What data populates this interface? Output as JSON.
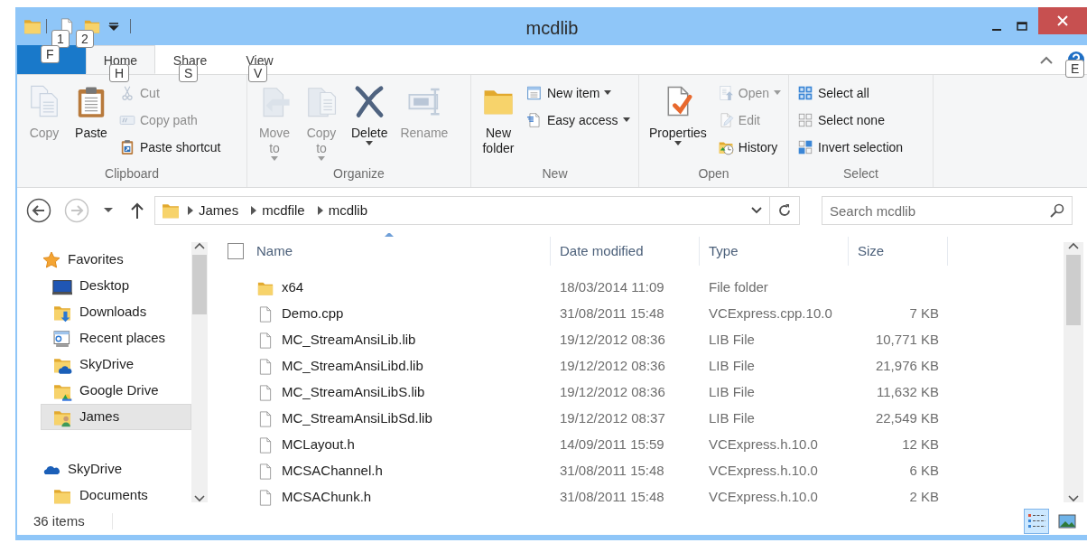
{
  "title_bar": {
    "title": "mcdlib",
    "keytips": [
      "1",
      "2"
    ]
  },
  "ribbon": {
    "file_tab": {
      "keytip": "F"
    },
    "tabs": [
      {
        "label": "Home",
        "keytip": "H",
        "selected": true
      },
      {
        "label": "Share",
        "keytip": "S",
        "selected": false
      },
      {
        "label": "View",
        "keytip": "V",
        "selected": false
      }
    ],
    "help_keytip": "E",
    "groups": [
      {
        "label": "Clipboard",
        "items": [
          {
            "kind": "large",
            "label": "Copy",
            "disabled": true,
            "dropdown": false
          },
          {
            "kind": "large",
            "label": "Paste",
            "disabled": false,
            "dropdown": false
          },
          {
            "kind": "small",
            "label": "Cut",
            "disabled": true,
            "dropdown": false
          },
          {
            "kind": "small",
            "label": "Copy path",
            "disabled": true,
            "dropdown": false
          },
          {
            "kind": "small",
            "label": "Paste shortcut",
            "disabled": false,
            "dropdown": false
          }
        ]
      },
      {
        "label": "Organize",
        "items": [
          {
            "kind": "large",
            "label": "Move to",
            "disabled": true,
            "dropdown": true
          },
          {
            "kind": "large",
            "label": "Copy to",
            "disabled": true,
            "dropdown": true
          },
          {
            "kind": "large",
            "label": "Delete",
            "disabled": false,
            "dropdown": true
          },
          {
            "kind": "large",
            "label": "Rename",
            "disabled": true,
            "dropdown": false
          }
        ]
      },
      {
        "label": "New",
        "items": [
          {
            "kind": "large",
            "label": "New folder",
            "disabled": false,
            "dropdown": false
          },
          {
            "kind": "small",
            "label": "New item",
            "disabled": false,
            "dropdown": true
          },
          {
            "kind": "small",
            "label": "Easy access",
            "disabled": false,
            "dropdown": true
          }
        ]
      },
      {
        "label": "Open",
        "items": [
          {
            "kind": "large",
            "label": "Properties",
            "disabled": false,
            "dropdown": true
          },
          {
            "kind": "small",
            "label": "Open",
            "disabled": true,
            "dropdown": true
          },
          {
            "kind": "small",
            "label": "Edit",
            "disabled": true,
            "dropdown": false
          },
          {
            "kind": "small",
            "label": "History",
            "disabled": false,
            "dropdown": false
          }
        ]
      },
      {
        "label": "Select",
        "items": [
          {
            "kind": "small",
            "label": "Select all",
            "disabled": false,
            "dropdown": false
          },
          {
            "kind": "small",
            "label": "Select none",
            "disabled": false,
            "dropdown": false
          },
          {
            "kind": "small",
            "label": "Invert selection",
            "disabled": false,
            "dropdown": false
          }
        ]
      }
    ]
  },
  "navigation": {
    "forward_disabled": true,
    "breadcrumbs": [
      "James",
      "mcdfile",
      "mcdlib"
    ],
    "search": {
      "placeholder": "Search mcdlib"
    }
  },
  "sidebar": {
    "items": [
      {
        "label": "Favorites",
        "selected": false,
        "children": [
          {
            "label": "Desktop",
            "selected": false
          },
          {
            "label": "Downloads",
            "selected": false
          },
          {
            "label": "Recent places",
            "selected": false
          },
          {
            "label": "SkyDrive",
            "selected": false
          },
          {
            "label": "Google Drive",
            "selected": false
          },
          {
            "label": "James",
            "selected": true
          }
        ]
      },
      {
        "label": "SkyDrive",
        "selected": false,
        "children": [
          {
            "label": "Documents",
            "selected": false
          }
        ]
      }
    ]
  },
  "file_list": {
    "select_all_checked": false,
    "columns": [
      {
        "label": "Name",
        "sorted": true
      },
      {
        "label": "Date modified",
        "sorted": false
      },
      {
        "label": "Type",
        "sorted": false
      },
      {
        "label": "Size",
        "sorted": false
      }
    ],
    "rows": [
      {
        "kind": "folder",
        "name": "x64",
        "date": "18/03/2014 11:09",
        "type": "File folder"
      },
      {
        "kind": "file",
        "name": "Demo.cpp",
        "date": "31/08/2011 15:48",
        "type": "VCExpress.cpp.10.0",
        "size": "7 KB"
      },
      {
        "kind": "file",
        "name": "MC_StreamAnsiLib.lib",
        "date": "19/12/2012 08:36",
        "type": "LIB File",
        "size": "10,771 KB"
      },
      {
        "kind": "file",
        "name": "MC_StreamAnsiLibd.lib",
        "date": "19/12/2012 08:36",
        "type": "LIB File",
        "size": "21,976 KB"
      },
      {
        "kind": "file",
        "name": "MC_StreamAnsiLibS.lib",
        "date": "19/12/2012 08:36",
        "type": "LIB File",
        "size": "11,632 KB"
      },
      {
        "kind": "file",
        "name": "MC_StreamAnsiLibSd.lib",
        "date": "19/12/2012 08:37",
        "type": "LIB File",
        "size": "22,549 KB"
      },
      {
        "kind": "file",
        "name": "MCLayout.h",
        "date": "14/09/2011 15:59",
        "type": "VCExpress.h.10.0",
        "size": "12 KB"
      },
      {
        "kind": "file",
        "name": "MCSAChannel.h",
        "date": "31/08/2011 15:48",
        "type": "VCExpress.h.10.0",
        "size": "6 KB"
      },
      {
        "kind": "file",
        "name": "MCSAChunk.h",
        "date": "31/08/2011 15:48",
        "type": "VCExpress.h.10.0",
        "size": "2 KB"
      }
    ]
  },
  "status_bar": {
    "item_count": "36 items",
    "views": [
      {
        "selected": true
      },
      {
        "selected": false
      }
    ]
  }
}
